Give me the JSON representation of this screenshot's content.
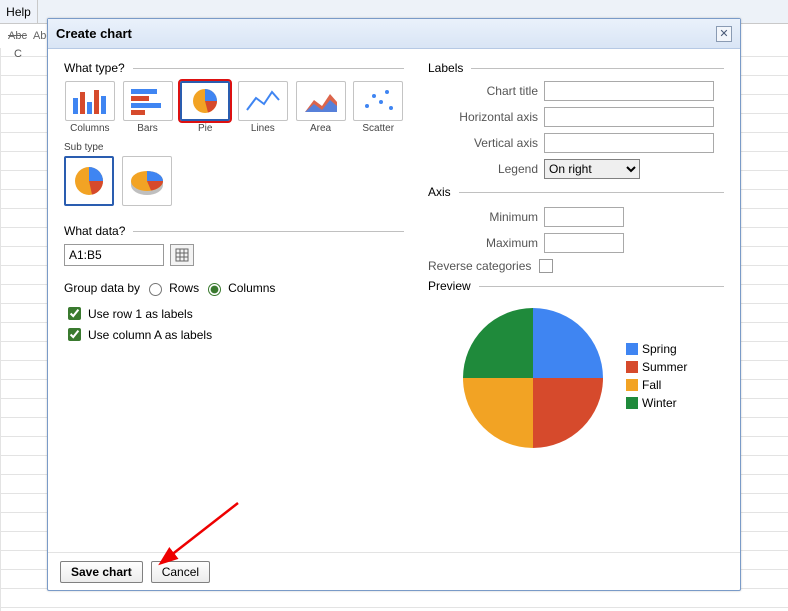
{
  "bg": {
    "help_menu": "Help",
    "abc_tool": "Abc",
    "abc_strike": "Abc",
    "col_c": "C"
  },
  "dialog": {
    "title": "Create chart",
    "sections": {
      "what_type": "What type?",
      "sub_type": "Sub type",
      "what_data": "What data?",
      "labels": "Labels",
      "axis": "Axis",
      "preview": "Preview"
    },
    "type_captions": {
      "columns": "Columns",
      "bars": "Bars",
      "pie": "Pie",
      "lines": "Lines",
      "area": "Area",
      "scatter": "Scatter"
    },
    "data_range": "A1:B5",
    "group_by_label": "Group data by",
    "group_rows": "Rows",
    "group_columns": "Columns",
    "use_row1": "Use row 1 as labels",
    "use_colA": "Use column A as labels",
    "label_fields": {
      "chart_title": "Chart title",
      "h_axis": "Horizontal axis",
      "v_axis": "Vertical axis",
      "legend": "Legend",
      "legend_value": "On right"
    },
    "axis_fields": {
      "minimum": "Minimum",
      "maximum": "Maximum",
      "reverse": "Reverse categories"
    },
    "buttons": {
      "save": "Save chart",
      "cancel": "Cancel"
    }
  },
  "chart_data": {
    "type": "pie",
    "title": "",
    "series": [
      {
        "name": "Spring",
        "value": 25,
        "color": "#3f85f2"
      },
      {
        "name": "Summer",
        "value": 25,
        "color": "#d64a2c"
      },
      {
        "name": "Fall",
        "value": 25,
        "color": "#f2a324"
      },
      {
        "name": "Winter",
        "value": 25,
        "color": "#1f8a3b"
      }
    ],
    "legend_position": "right"
  }
}
